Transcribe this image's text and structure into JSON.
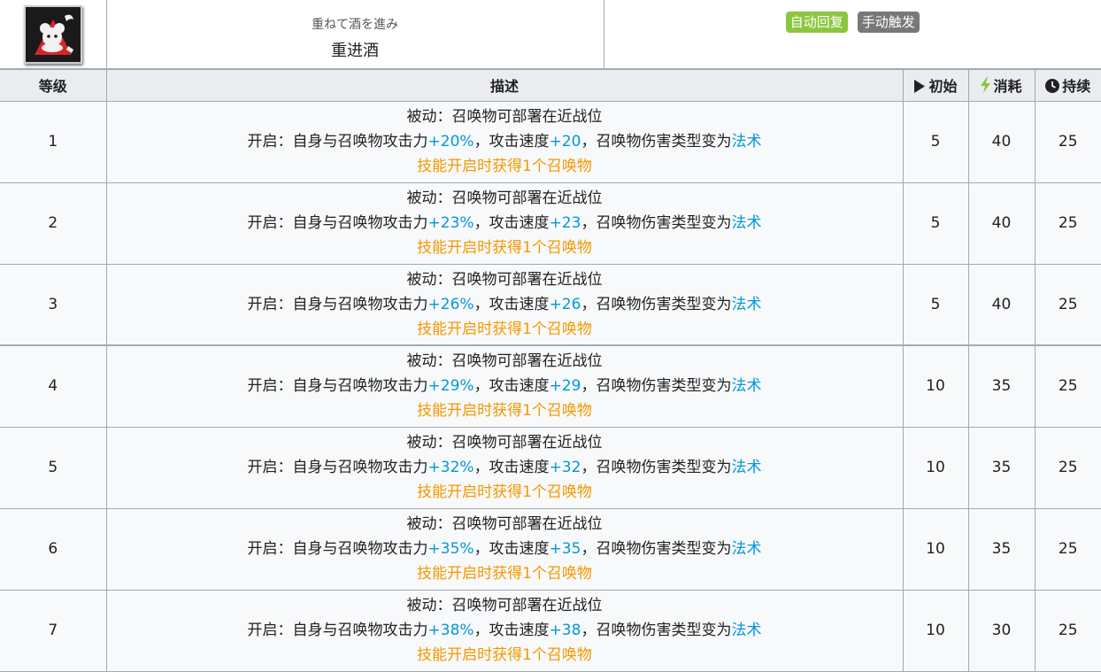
{
  "skill": {
    "name_jp": "重ねて酒を進み",
    "name_cn": "重进酒",
    "icon": "skill-icon-wine-figure",
    "tags": [
      {
        "label": "自动回复",
        "color": "#8cc63f"
      },
      {
        "label": "手动触发",
        "color": "#787878"
      }
    ]
  },
  "columns": {
    "level": "等级",
    "desc": "描述",
    "init": "初始",
    "cost": "消耗",
    "duration": "持续",
    "init_icon": "play-icon",
    "cost_icon": "lightning-icon",
    "duration_icon": "clock-icon"
  },
  "rows": [
    {
      "level": "1",
      "passive": "被动：召唤物可部署在近战位",
      "open_prefix": "开启：自身与召唤物攻击力",
      "atk": "+20%",
      "mid": "，攻击速度",
      "aspd": "+20",
      "suffix": "，召唤物伤害类型变为",
      "type": "法术",
      "note": "技能开启时获得1个召唤物",
      "init": "5",
      "cost": "40",
      "duration": "25"
    },
    {
      "level": "2",
      "passive": "被动：召唤物可部署在近战位",
      "open_prefix": "开启：自身与召唤物攻击力",
      "atk": "+23%",
      "mid": "，攻击速度",
      "aspd": "+23",
      "suffix": "，召唤物伤害类型变为",
      "type": "法术",
      "note": "技能开启时获得1个召唤物",
      "init": "5",
      "cost": "40",
      "duration": "25"
    },
    {
      "level": "3",
      "passive": "被动：召唤物可部署在近战位",
      "open_prefix": "开启：自身与召唤物攻击力",
      "atk": "+26%",
      "mid": "，攻击速度",
      "aspd": "+26",
      "suffix": "，召唤物伤害类型变为",
      "type": "法术",
      "note": "技能开启时获得1个召唤物",
      "init": "5",
      "cost": "40",
      "duration": "25"
    },
    {
      "level": "4",
      "passive": "被动：召唤物可部署在近战位",
      "open_prefix": "开启：自身与召唤物攻击力",
      "atk": "+29%",
      "mid": "，攻击速度",
      "aspd": "+29",
      "suffix": "，召唤物伤害类型变为",
      "type": "法术",
      "note": "技能开启时获得1个召唤物",
      "init": "10",
      "cost": "35",
      "duration": "25"
    },
    {
      "level": "5",
      "passive": "被动：召唤物可部署在近战位",
      "open_prefix": "开启：自身与召唤物攻击力",
      "atk": "+32%",
      "mid": "，攻击速度",
      "aspd": "+32",
      "suffix": "，召唤物伤害类型变为",
      "type": "法术",
      "note": "技能开启时获得1个召唤物",
      "init": "10",
      "cost": "35",
      "duration": "25"
    },
    {
      "level": "6",
      "passive": "被动：召唤物可部署在近战位",
      "open_prefix": "开启：自身与召唤物攻击力",
      "atk": "+35%",
      "mid": "，攻击速度",
      "aspd": "+35",
      "suffix": "，召唤物伤害类型变为",
      "type": "法术",
      "note": "技能开启时获得1个召唤物",
      "init": "10",
      "cost": "35",
      "duration": "25"
    },
    {
      "level": "7",
      "passive": "被动：召唤物可部署在近战位",
      "open_prefix": "开启：自身与召唤物攻击力",
      "atk": "+38%",
      "mid": "，攻击速度",
      "aspd": "+38",
      "suffix": "，召唤物伤害类型变为",
      "type": "法术",
      "note": "技能开启时获得1个召唤物",
      "init": "10",
      "cost": "30",
      "duration": "25"
    }
  ]
}
